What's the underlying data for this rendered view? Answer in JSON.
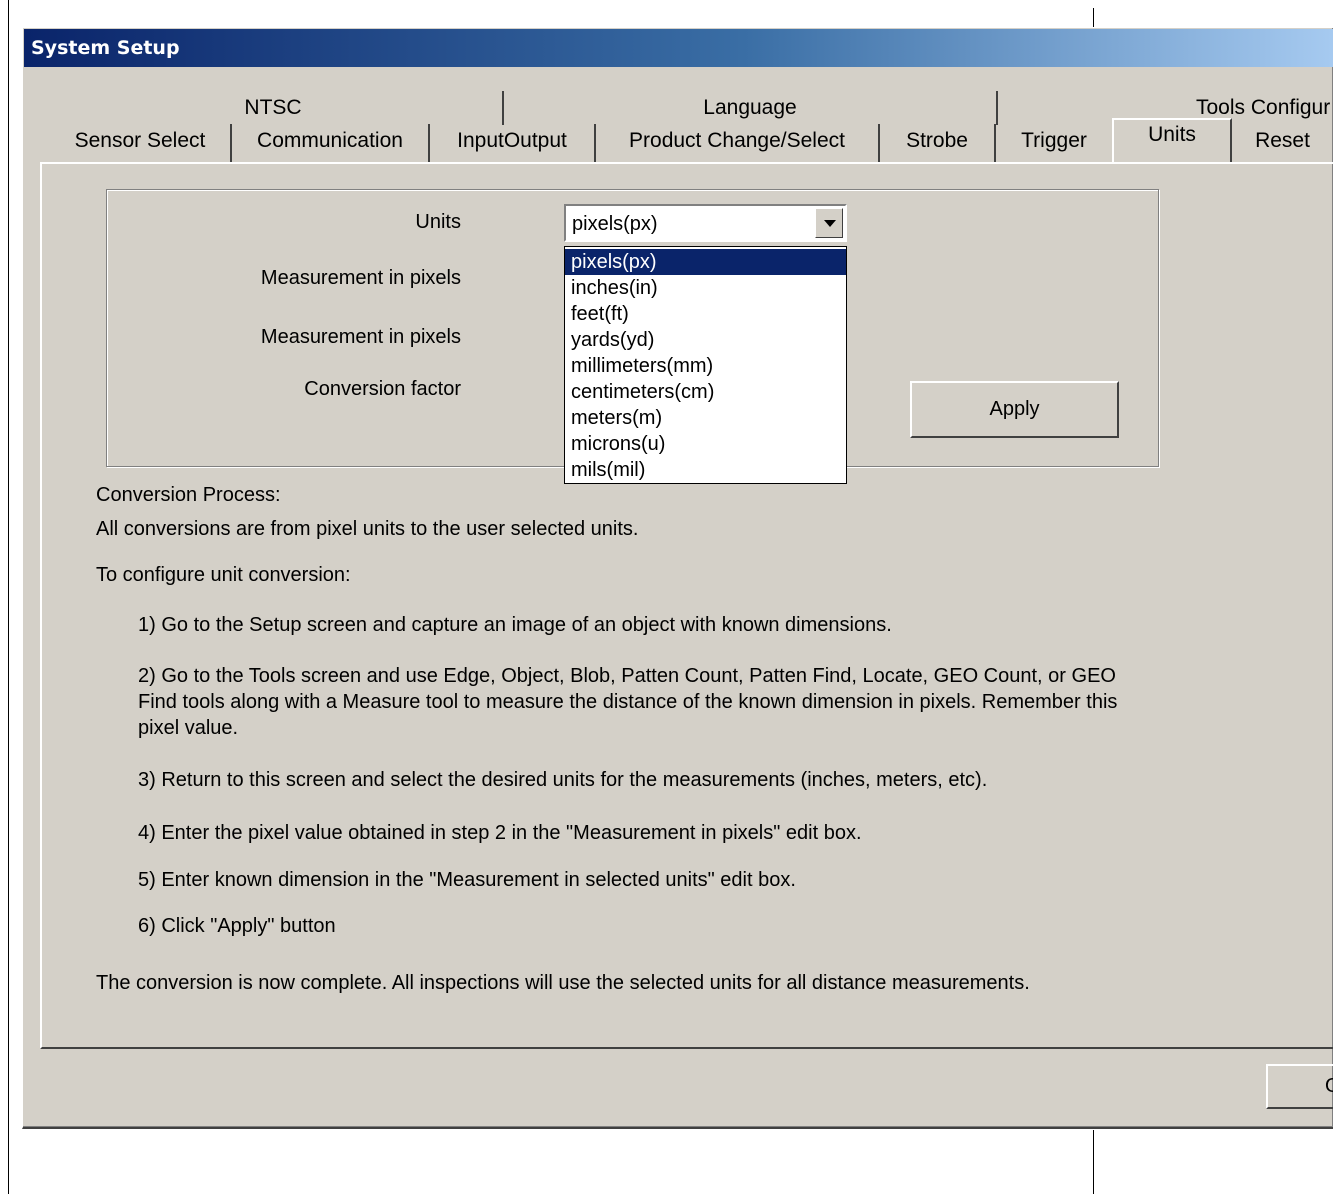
{
  "window": {
    "title": "System Setup"
  },
  "tabs_back_row": [
    "NTSC",
    "Language",
    "Tools Configur"
  ],
  "tabs_front_row": [
    "Sensor Select",
    "Communication",
    "InputOutput",
    "Product Change/Select",
    "Strobe",
    "Trigger",
    "Units",
    "Reset"
  ],
  "active_tab": "Units",
  "form": {
    "units_label": "Units",
    "measurement_pixels_label_1": "Measurement in  pixels",
    "measurement_pixels_label_2": "Measurement in pixels",
    "conversion_factor_label": "Conversion factor",
    "units_selected": "pixels(px)",
    "units_options": [
      "pixels(px)",
      "inches(in)",
      "feet(ft)",
      "yards(yd)",
      "millimeters(mm)",
      "centimeters(cm)",
      "meters(m)",
      "microns(u)",
      "mils(mil)"
    ],
    "apply_label": "Apply"
  },
  "instructions": {
    "heading": "Conversion Process:",
    "line1": "All conversions are from pixel units to the user selected units.",
    "line2": "To configure unit conversion:",
    "step1": "1) Go to the Setup screen and capture an image of an object with known dimensions.",
    "step2": "2) Go to the Tools screen and use Edge, Object, Blob, Patten Count, Patten Find, Locate, GEO Count, or GEO Find tools along with a Measure tool to measure the distance of the known dimension in pixels. Remember this pixel value.",
    "step3": "3) Return to this screen and select the desired units for the measurements (inches, meters, etc).",
    "step4": "4) Enter the pixel value obtained in step 2 in the \"Measurement in pixels\" edit box.",
    "step5": "5) Enter known dimension in the \"Measurement in selected units\" edit box.",
    "step6": "6) Click \"Apply\" button",
    "footer": "The conversion is now complete.  All inspections will use the selected units for all distance measurements."
  },
  "bottom_button_label": "O"
}
